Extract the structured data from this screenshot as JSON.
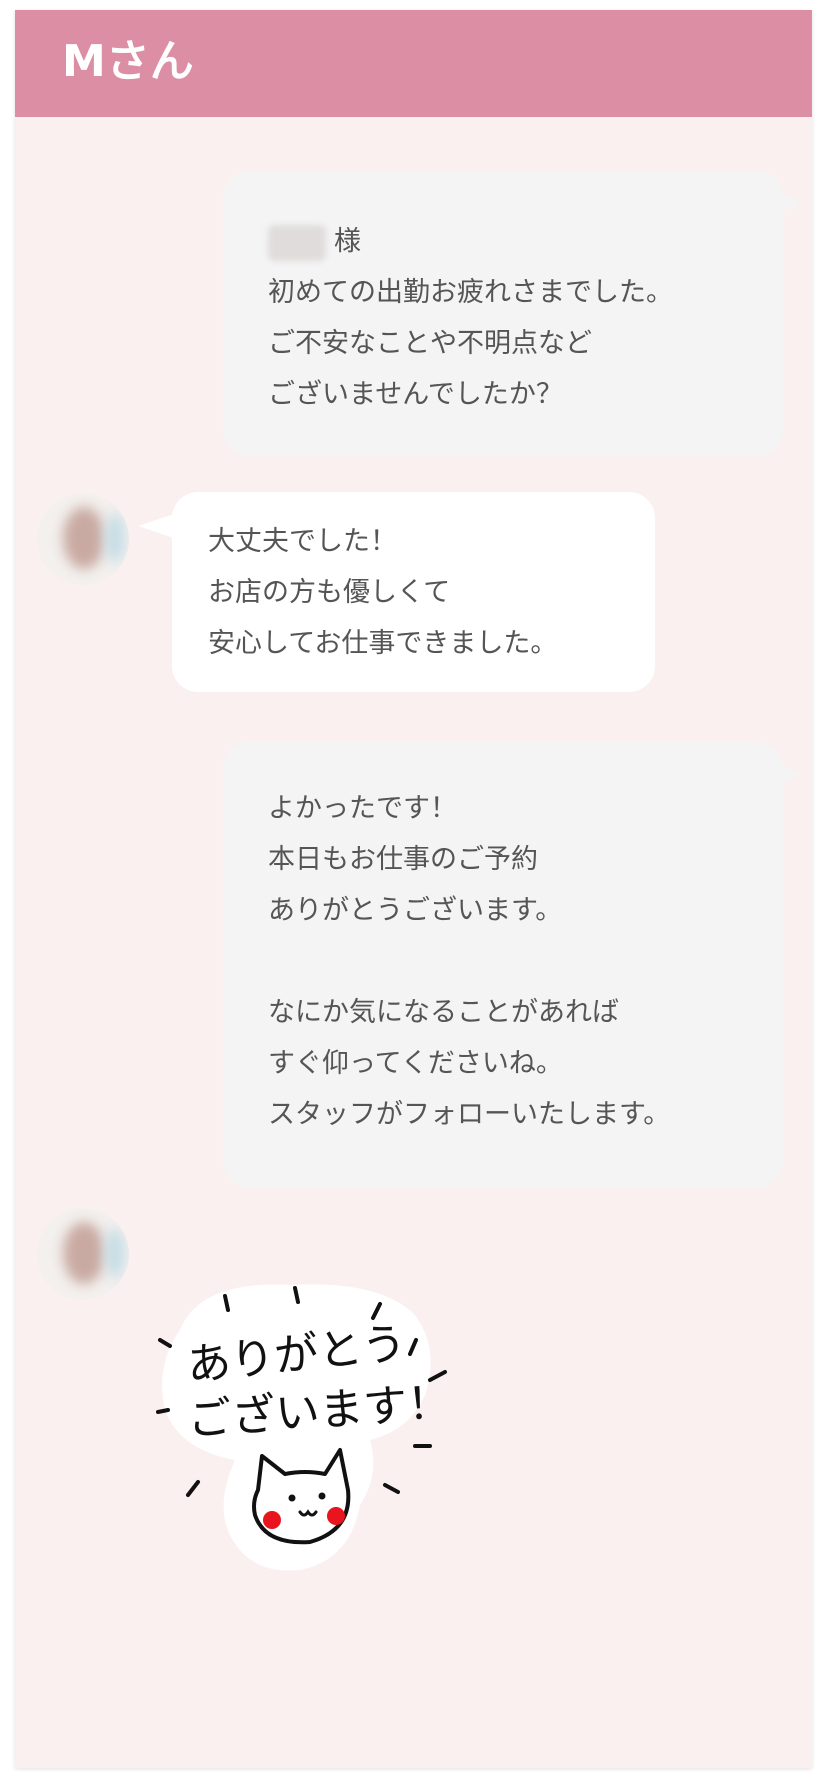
{
  "header": {
    "title": "Mさん"
  },
  "messages": [
    {
      "from": "staff",
      "suffix": "様",
      "lines": [
        "初めての出勤お疲れさまでした。",
        "ご不安なことや不明点など",
        "ございませんでしたか？"
      ]
    },
    {
      "from": "user",
      "lines": [
        "大丈夫でした！",
        "お店の方も優しくて",
        "安心してお仕事できました。"
      ]
    },
    {
      "from": "staff",
      "lines": [
        "よかったです！",
        "本日もお仕事のご予約",
        "ありがとうございます。",
        "",
        "なにか気になることがあれば",
        "すぐ仰ってくださいね。",
        "スタッフがフォローいたします。"
      ]
    }
  ],
  "sticker": {
    "line1": "ありがとう",
    "line2": "ございます！",
    "icon": "cat-thank-you-sticker"
  },
  "colors": {
    "header": "#dc8ea4",
    "background": "#faf0f0",
    "staff_bubble": "#f4f4f4",
    "user_bubble": "#ffffff",
    "text": "#555555"
  }
}
